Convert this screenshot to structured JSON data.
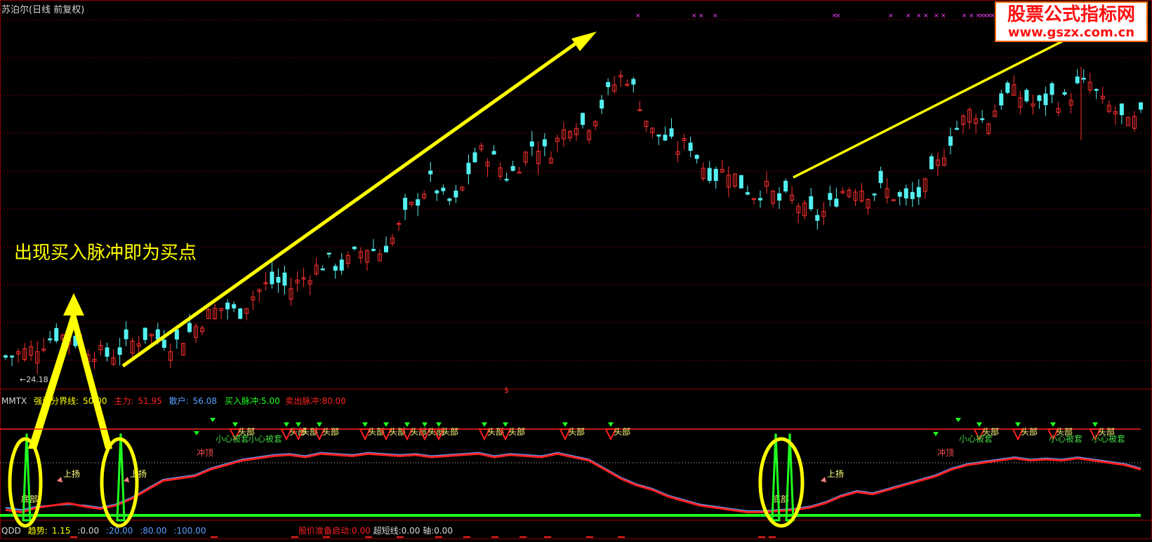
{
  "window": {
    "title": "苏泊尔(日线 前复权)"
  },
  "annotation": "出现买入脉冲即为买点",
  "watermark": {
    "line1": "股票公式指标网",
    "line2": "www.gszx.com.cn"
  },
  "price_chart": {
    "min_price_label": "←24.18",
    "dollar_marker": "$"
  },
  "indicator_panel": {
    "name": "MMTX",
    "boundary_label": "强弱分界线:",
    "boundary_value": "50.00",
    "main_label": "主力:",
    "main_value": "51.95",
    "retail_label": "散户:",
    "retail_value": "56.08",
    "buy_pulse_label": "买入脉冲:",
    "buy_pulse_value": "5.00",
    "sell_pulse_label": "卖出脉冲:",
    "sell_pulse_value": "80.00",
    "signals": {
      "top": "头部",
      "careful": "小心被套",
      "charge_top": "冲顶",
      "rise": "上扬",
      "bottom": "底部"
    }
  },
  "qdd_panel": {
    "name": "QDD",
    "trend_label": "趋势:",
    "trend_value": "1.15",
    "levels": [
      ":0.00",
      ":20.00",
      ":80.00",
      ":100.00"
    ],
    "start_label": "股价准备启动:",
    "start_value": "0.00",
    "short_label": "超短线:",
    "short_value": "0.00",
    "axis_label": "轴:",
    "axis_value": "0.00"
  },
  "colors": {
    "up": "#ff3030",
    "down": "#54f0f0",
    "arrow": "#ffff00",
    "main_line": "#ff2020",
    "retail_line": "#5aa0ff",
    "pulse": "#20ff20",
    "x_marks": "#ff3cff"
  },
  "chart_data": [
    {
      "type": "candlestick",
      "title": "苏泊尔(日线 前复权)",
      "price_min_label": 24.18,
      "trend": "rising then falling then rising",
      "close_path": [
        24.6,
        24.9,
        25.2,
        25.8,
        26.4,
        26.1,
        25.5,
        25.0,
        24.7,
        25.2,
        25.9,
        26.4,
        26.0,
        25.6,
        26.3,
        27.3,
        28.2,
        28.6,
        28.0,
        29.3,
        30.2,
        30.6,
        30.0,
        30.8,
        31.6,
        32.2,
        31.7,
        32.6,
        33.3,
        32.9,
        34.0,
        35.8,
        37.2,
        38.6,
        37.0,
        36.8,
        39.6,
        41.0,
        40.1,
        38.8,
        40.2,
        41.7,
        40.6,
        42.1,
        43.5,
        42.8,
        44.2,
        46.0,
        47.1,
        45.2,
        42.5,
        42.0,
        41.1,
        41.6,
        39.8,
        38.9,
        39.6,
        38.3,
        37.5,
        37.9,
        37.0,
        37.2,
        36.1,
        35.6,
        36.7,
        37.9,
        38.2,
        37.6,
        38.0,
        37.3,
        36.8,
        37.6,
        39.2,
        41.5,
        43.1,
        44.3,
        43.0,
        44.8,
        45.6,
        45.1,
        44.4,
        45.2,
        44.8,
        45.9,
        46.4,
        44.7,
        44.1,
        42.9,
        43.6
      ],
      "sell_marks_x": [
        0.555,
        0.605,
        0.615,
        0.62,
        0.724,
        0.772,
        0.788,
        0.8,
        0.812,
        0.815,
        0.83,
        0.85,
        0.84,
        0.845,
        0.85,
        0.855,
        0.86,
        0.865,
        0.86
      ]
    },
    {
      "type": "line",
      "series": [
        {
          "name": "主力",
          "values": [
            8,
            6,
            10,
            12,
            14,
            11,
            9,
            12,
            18,
            26,
            34,
            36,
            38,
            44,
            48,
            52,
            54,
            56,
            57,
            55,
            58,
            57,
            56,
            58,
            57,
            56,
            57,
            55,
            56,
            57,
            58,
            55,
            57,
            56,
            55,
            58,
            55,
            52,
            44,
            36,
            30,
            26,
            20,
            16,
            12,
            10,
            8,
            6,
            6,
            7,
            8,
            10,
            14,
            20,
            24,
            22,
            26,
            30,
            34,
            38,
            44,
            48,
            50,
            52,
            54,
            52,
            53,
            52,
            54,
            52,
            50,
            48,
            44
          ]
        },
        {
          "name": "散户",
          "values": [
            10,
            8,
            11,
            12,
            13,
            12,
            10,
            13,
            19,
            27,
            35,
            37,
            39,
            45,
            49,
            53,
            55,
            57,
            58,
            56,
            59,
            58,
            57,
            59,
            58,
            57,
            58,
            56,
            57,
            58,
            59,
            56,
            58,
            57,
            56,
            59,
            56,
            53,
            45,
            37,
            31,
            27,
            21,
            17,
            13,
            11,
            9,
            7,
            7,
            8,
            9,
            11,
            15,
            21,
            25,
            23,
            27,
            31,
            35,
            39,
            45,
            49,
            51,
            53,
            55,
            53,
            54,
            53,
            55,
            53,
            51,
            49,
            45
          ]
        }
      ],
      "hlines": [
        {
          "label": "强弱分界线",
          "value": 50
        },
        {
          "label": "卖出脉冲",
          "value": 80
        },
        {
          "label": "买入脉冲",
          "value": 5
        }
      ],
      "ylim": [
        0,
        100
      ]
    }
  ]
}
